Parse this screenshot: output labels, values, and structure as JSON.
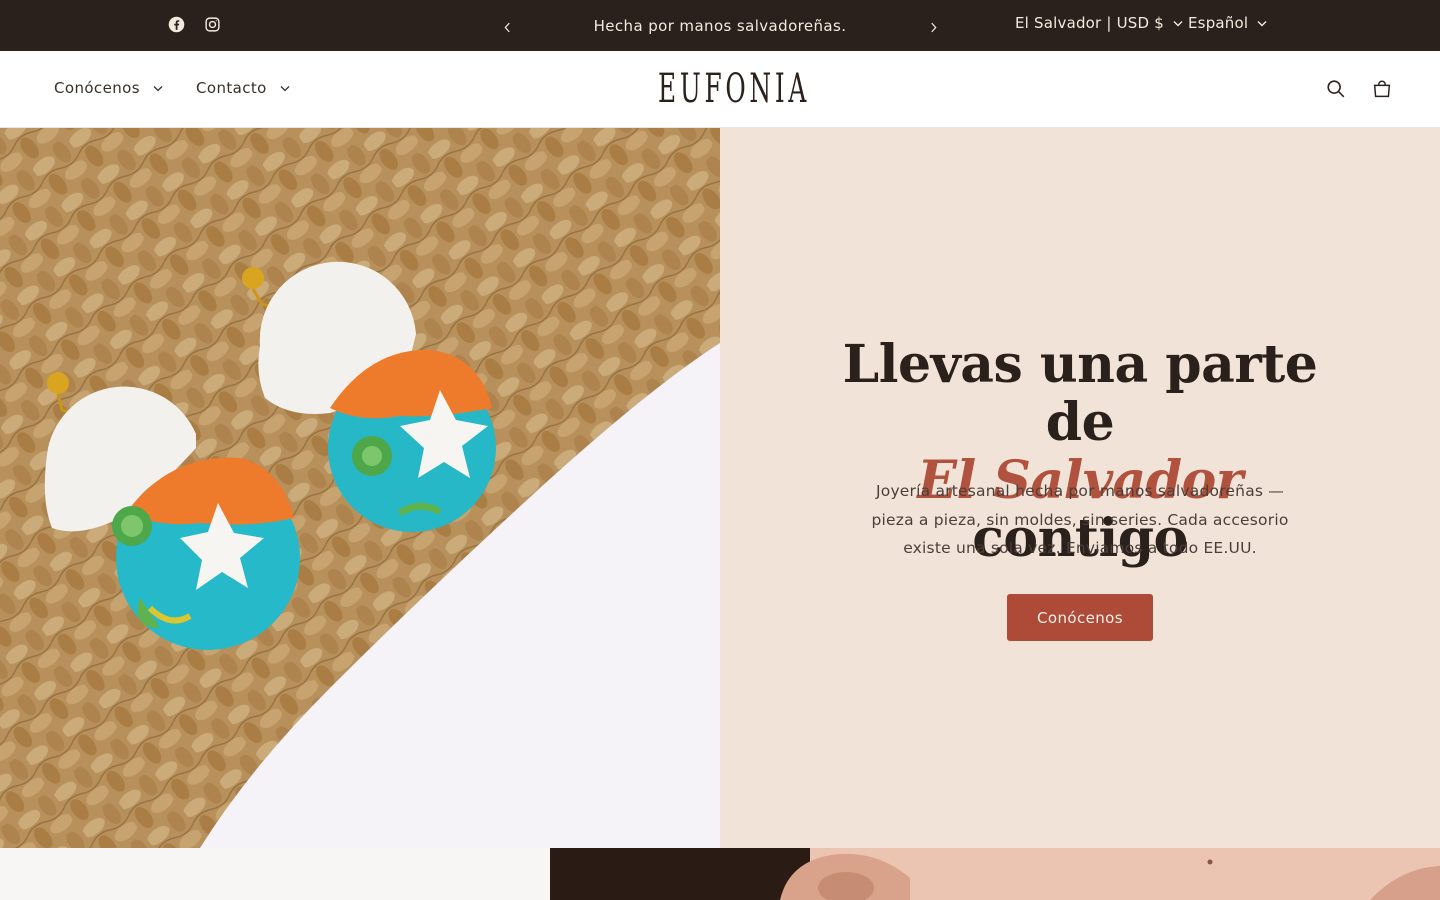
{
  "topbar": {
    "announcement": "Hecha por manos salvadoreñas.",
    "region": "El Salvador | USD $",
    "language": "Español",
    "social": [
      "facebook-icon",
      "instagram-icon"
    ],
    "background": "#2a211c"
  },
  "header": {
    "nav": [
      {
        "label": "Conócenos"
      },
      {
        "label": "Contacto"
      }
    ],
    "logo": "EUFONIA",
    "icons": [
      "search-icon",
      "cart-icon"
    ]
  },
  "hero": {
    "headline_line1": "Llevas una parte de",
    "headline_accent": "El Salvador",
    "headline_end": " contigo",
    "subtext": "Joyería artesanal hecha por manos salvadoreñas — pieza a pieza, sin moldes, sin series. Cada accesorio existe una sola vez. Enviamos a todo EE.UU.",
    "cta_label": "Conócenos",
    "panel_color": "#f2e3d8",
    "accent_color": "#b1523e",
    "button_color": "#ad4a38"
  }
}
